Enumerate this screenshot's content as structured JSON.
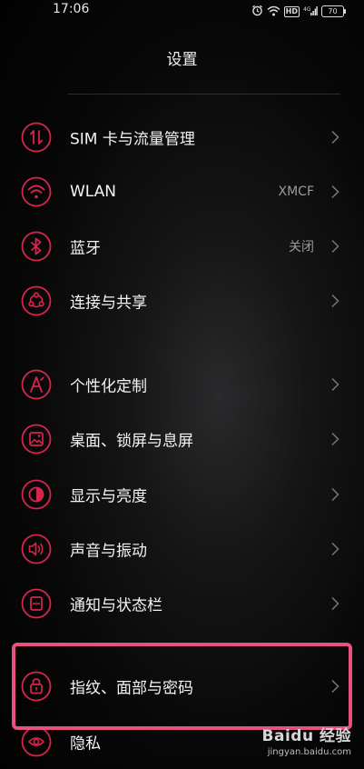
{
  "status": {
    "time": "17:06",
    "hd_badge": "HD",
    "battery": "70",
    "icons": [
      "alarm-icon",
      "wifi-icon",
      "hd-icon",
      "signal-icon",
      "battery-icon"
    ]
  },
  "header": {
    "title": "设置"
  },
  "colors": {
    "accent": "#d8244c",
    "highlight": "#e8507e",
    "text": "#f4f4f4",
    "secondary": "#9a9a9a"
  },
  "settings": {
    "items": [
      {
        "label": "SIM 卡与流量管理",
        "value": "",
        "icon": "sim-data-icon"
      },
      {
        "label": "WLAN",
        "value": "XMCF",
        "icon": "wifi-icon"
      },
      {
        "label": "蓝牙",
        "value": "关闭",
        "icon": "bluetooth-icon"
      },
      {
        "label": "连接与共享",
        "value": "",
        "icon": "share-icon"
      },
      {
        "label": "个性化定制",
        "value": "",
        "icon": "personalize-icon"
      },
      {
        "label": "桌面、锁屏与息屏",
        "value": "",
        "icon": "wallpaper-icon"
      },
      {
        "label": "显示与亮度",
        "value": "",
        "icon": "brightness-icon"
      },
      {
        "label": "声音与振动",
        "value": "",
        "icon": "speaker-icon"
      },
      {
        "label": "通知与状态栏",
        "value": "",
        "icon": "notification-icon"
      },
      {
        "label": "指纹、面部与密码",
        "value": "",
        "icon": "lock-icon"
      },
      {
        "label": "隐私",
        "value": "",
        "icon": "privacy-eye-icon"
      }
    ]
  },
  "watermark": {
    "brand": "Baidu 经验",
    "url": "jingyan.baidu.com"
  }
}
